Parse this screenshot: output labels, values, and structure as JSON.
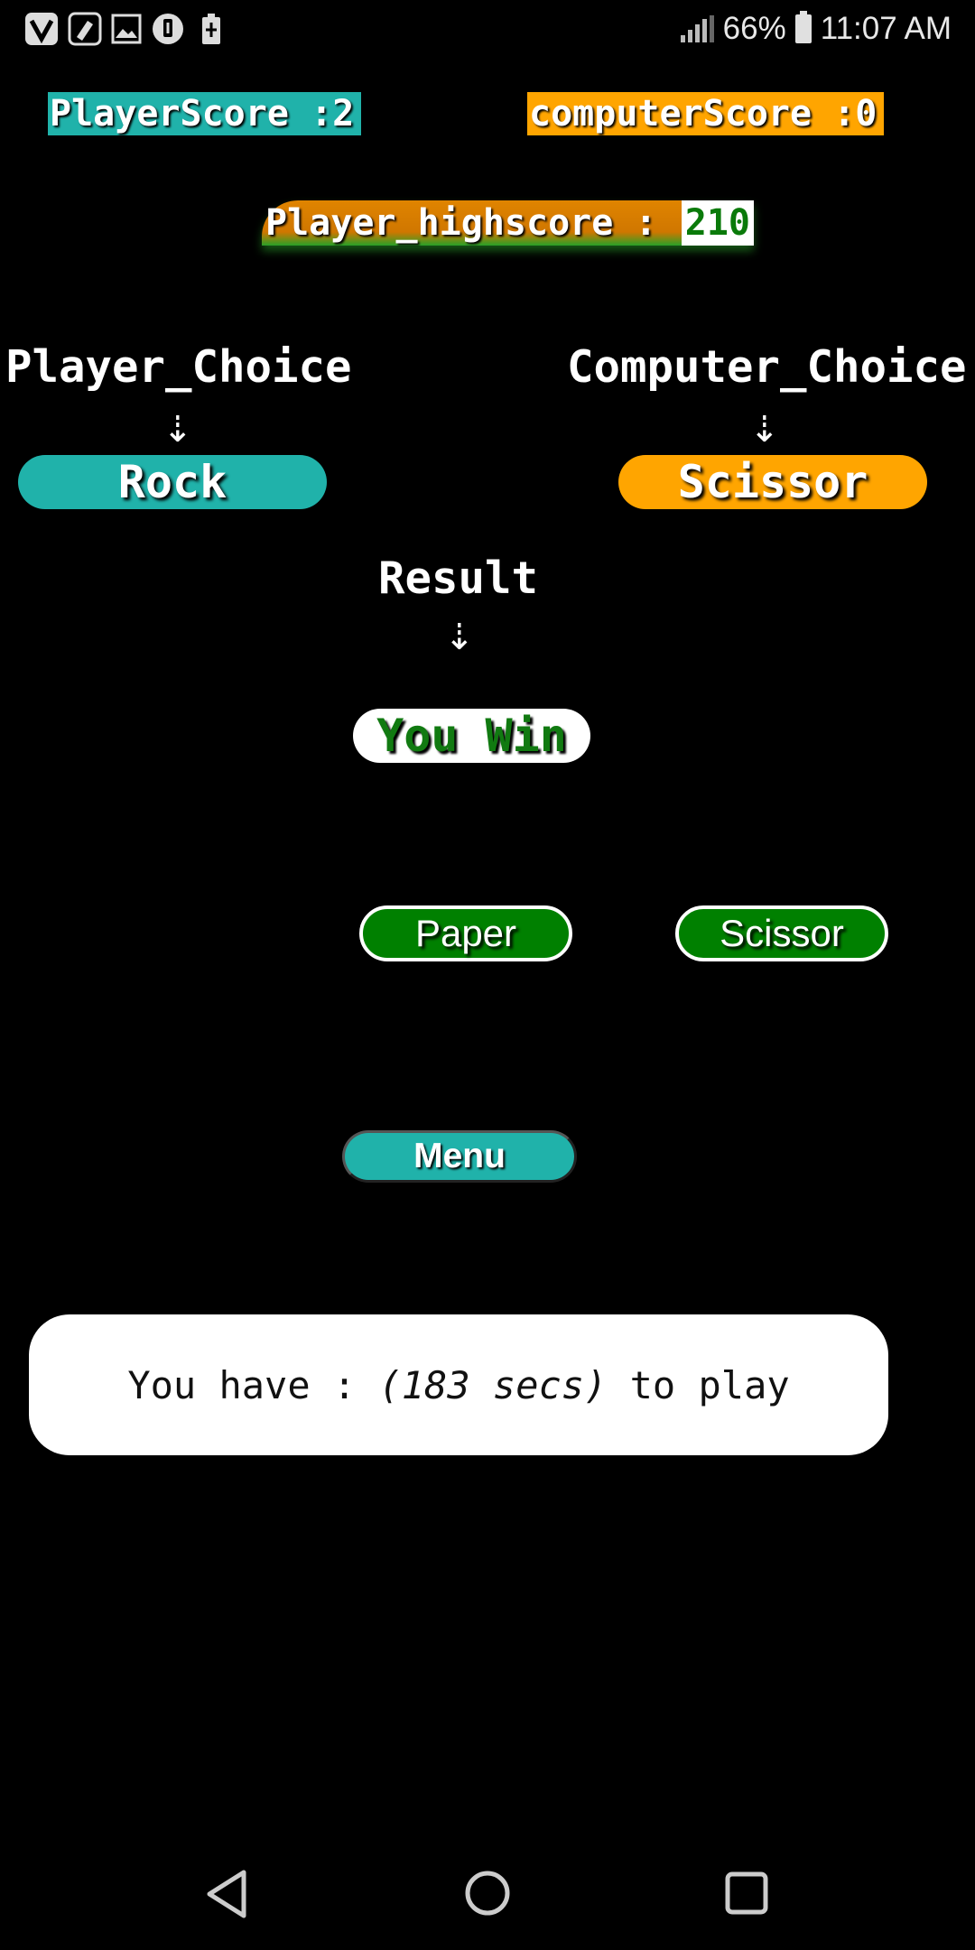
{
  "status_bar": {
    "notification_icons": [
      "v-app-icon",
      "clean-icon",
      "image-icon",
      "download-icon",
      "battery-saver-icon"
    ],
    "battery_percent": "66%",
    "time": "11:07 AM"
  },
  "scores": {
    "player_score": "PlayerScore :2",
    "computer_score": "computerScore :0",
    "highscore_label": "Player_highscore : ",
    "highscore_value": "210"
  },
  "choices": {
    "player_title": "Player_Choice",
    "computer_title": "Computer_Choice",
    "arrow": "⇣",
    "player_choice": "Rock",
    "computer_choice": "Scissor"
  },
  "result": {
    "title": "Result",
    "value": "You Win"
  },
  "buttons": {
    "paper": "Paper",
    "scissor": "Scissor",
    "menu": "Menu"
  },
  "timer": {
    "prefix": "You have : ",
    "secs": "(183 secs)",
    "suffix": " to play"
  },
  "colors": {
    "player": "#20b2aa",
    "computer": "#ffa500",
    "button_green": "#008000",
    "background": "#000000"
  }
}
